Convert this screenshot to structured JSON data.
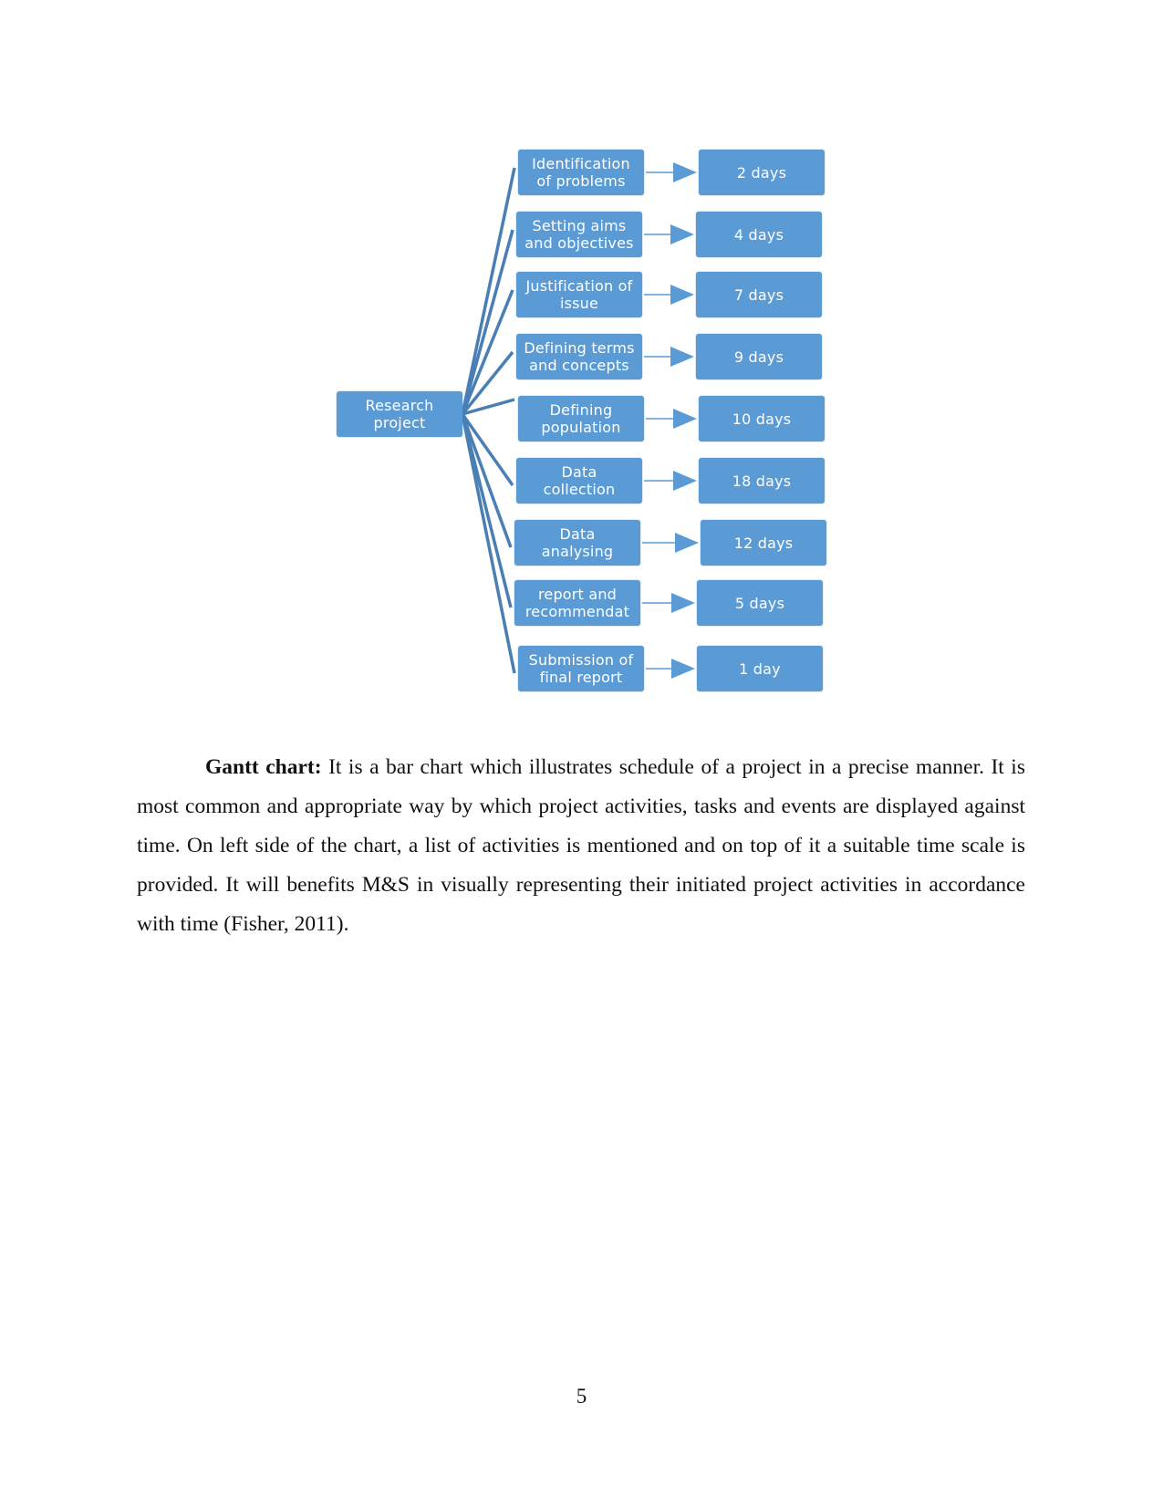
{
  "diagram": {
    "root": "Research project",
    "tasks": [
      {
        "label": "Identification of problems",
        "duration": "2 days"
      },
      {
        "label": "Setting aims and objectives",
        "duration": "4 days"
      },
      {
        "label": "Justification of issue",
        "duration": "7 days"
      },
      {
        "label": "Defining terms and concepts",
        "duration": "9 days"
      },
      {
        "label": "Defining population",
        "duration": "10 days"
      },
      {
        "label": "Data collection",
        "duration": "18 days"
      },
      {
        "label": "Data analysing",
        "duration": "12 days"
      },
      {
        "label": "report and recommendat",
        "duration": "5 days"
      },
      {
        "label": "Submission of final report",
        "duration": "1 day"
      }
    ],
    "colors": {
      "box": "#5b9bd5",
      "line": "#4a7fb5"
    }
  },
  "paragraph": {
    "heading": "Gantt chart:",
    "body": " It is a bar chart which illustrates schedule of a project in a precise manner. It is most common and appropriate way by which project activities, tasks and events are displayed against time. On left side of the chart, a list of activities is mentioned and on top of it a suitable time scale is provided. It will benefits M&S in visually representing their initiated project activities in accordance with time (Fisher, 2011)."
  },
  "page_number": "5"
}
